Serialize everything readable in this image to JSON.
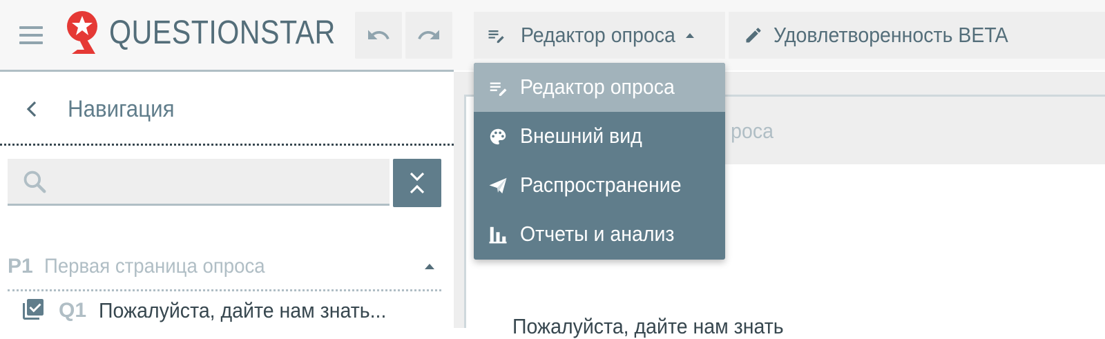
{
  "header": {
    "brand": "QUESTIONSTAR",
    "mode_tab_label": "Редактор опроса",
    "survey_tab_label": "Удовлетворенность BETA"
  },
  "mode_menu": {
    "items": [
      {
        "label": "Редактор опроса",
        "icon": "edit-list-icon",
        "active": true
      },
      {
        "label": "Внешний вид",
        "icon": "palette-icon",
        "active": false
      },
      {
        "label": "Распространение",
        "icon": "send-icon",
        "active": false
      },
      {
        "label": "Отчеты и анализ",
        "icon": "bar-chart-icon",
        "active": false
      }
    ]
  },
  "sidebar": {
    "title": "Навигация",
    "search": {
      "value": "",
      "placeholder": ""
    },
    "page": {
      "number": "P1",
      "title": "Первая страница опроса"
    },
    "questions": [
      {
        "number": "Q1",
        "text": "Пожалуйста, дайте нам знать...",
        "icon": "checkbox-list-icon"
      }
    ]
  },
  "main": {
    "card_title_partial": "роса",
    "question_text_partial": "Пожалуйста, дайте нам знать"
  },
  "colors": {
    "accent": "#607d8b",
    "accent_light": "#a2b3bb",
    "text": "#546e7a",
    "muted": "#b0bec5",
    "logo_red": "#e53935",
    "header_bg": "#f7f7f7"
  }
}
